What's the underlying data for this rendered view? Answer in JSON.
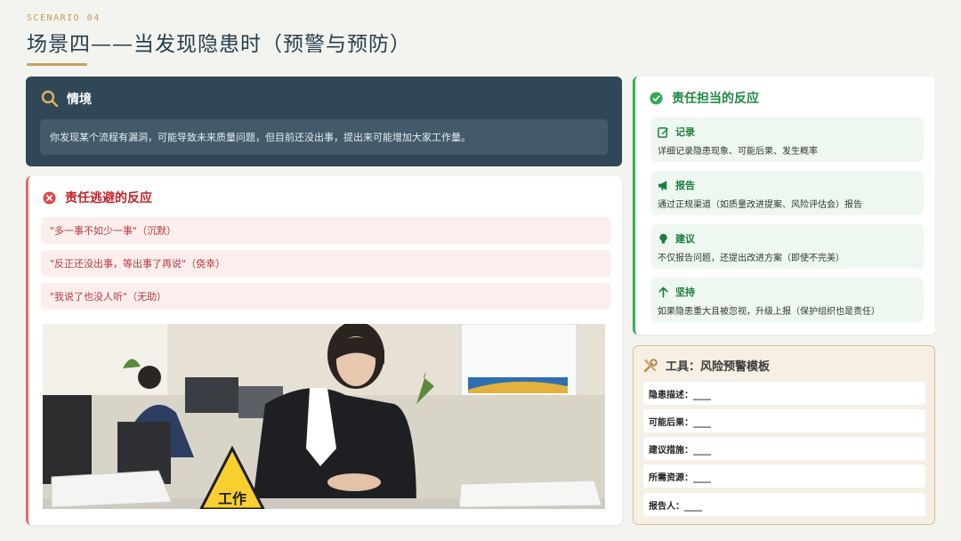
{
  "header": {
    "eyebrow": "SCENARIO 04",
    "title": "场景四——当发现隐患时（预警与预防）"
  },
  "situation": {
    "label": "情境",
    "text": "你发现某个流程有漏洞，可能导致未来质量问题，但目前还没出事，提出来可能增加大家工作量。"
  },
  "evasion": {
    "label": "责任逃避的反应",
    "items": [
      "\"多一事不如少一事\"（沉默）",
      "\"反正还没出事，等出事了再说\"（侥幸）",
      "\"我说了也没人听\"（无助）"
    ],
    "photo_sign": "工作"
  },
  "responsibility": {
    "label": "责任担当的反应",
    "items": [
      {
        "icon": "edit-icon",
        "title": "记录",
        "desc": "详细记录隐患现象、可能后果、发生概率"
      },
      {
        "icon": "megaphone-icon",
        "title": "报告",
        "desc": "通过正规渠道（如质量改进提案、风险评估会）报告"
      },
      {
        "icon": "lightbulb-icon",
        "title": "建议",
        "desc": "不仅报告问题，还提出改进方案（即使不完美）"
      },
      {
        "icon": "arrow-up-icon",
        "title": "坚持",
        "desc": "如果隐患重大且被忽视，升级上报（保护组织也是责任）"
      }
    ]
  },
  "tool": {
    "label": "工具：风险预警模板",
    "fields": [
      "隐患描述：____",
      "可能后果：____",
      "建议措施：____",
      "所需资源：____",
      "报告人：____"
    ]
  },
  "colors": {
    "navy": "#2f4756",
    "danger": "#c4232c",
    "success": "#1e8a43",
    "gold": "#c9a062"
  }
}
